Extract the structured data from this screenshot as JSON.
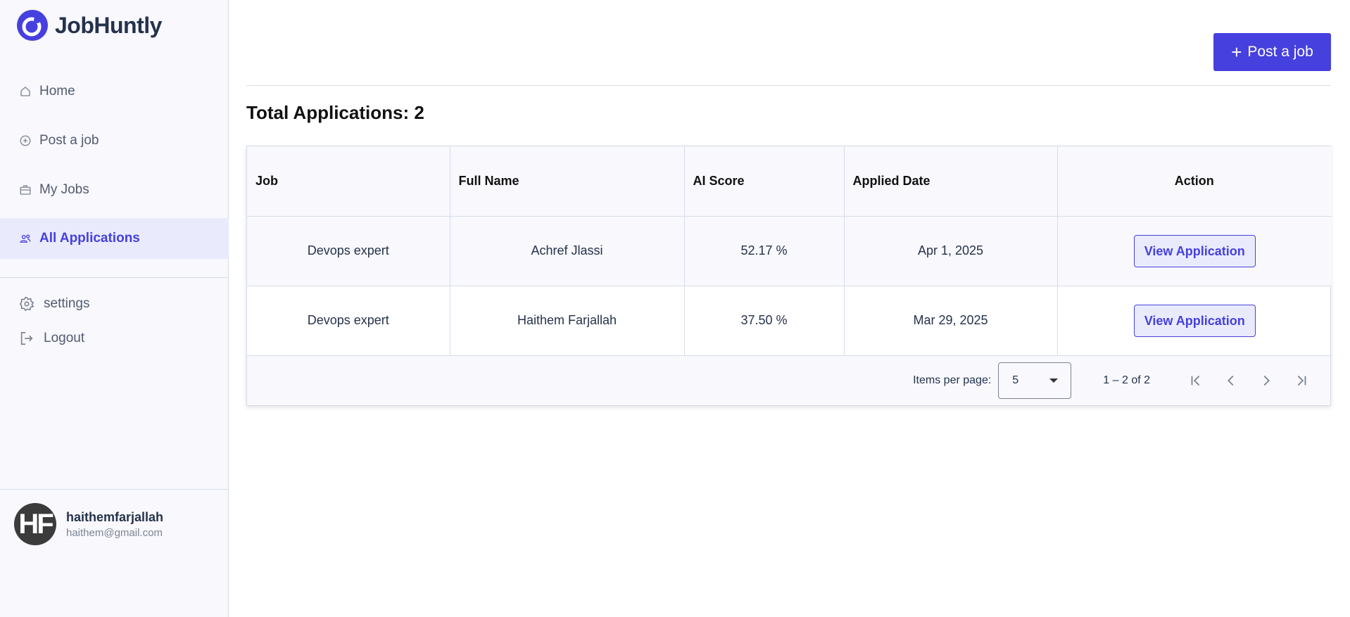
{
  "brand": {
    "name": "JobHuntly"
  },
  "sidebar": {
    "items": [
      {
        "label": "Home",
        "icon": "home-icon"
      },
      {
        "label": "Post a job",
        "icon": "plus-circle-icon"
      },
      {
        "label": "My Jobs",
        "icon": "briefcase-icon"
      },
      {
        "label": "All Applications",
        "icon": "users-icon",
        "active": true
      }
    ],
    "settings_label": "settings",
    "logout_label": "Logout"
  },
  "user": {
    "initials": "HF",
    "name": "haithemfarjallah",
    "email": "haithem@gmail.com"
  },
  "header": {
    "post_button_label": "Post a job"
  },
  "main": {
    "total_label": "Total Applications: 2",
    "table": {
      "headers": [
        "Job",
        "Full Name",
        "AI Score",
        "Applied Date",
        "Action"
      ],
      "rows": [
        {
          "job": "Devops expert",
          "full_name": "Achref Jlassi",
          "ai_score": "52.17 %",
          "applied_date": "Apr 1, 2025",
          "action": "View Application"
        },
        {
          "job": "Devops expert",
          "full_name": "Haithem Farjallah",
          "ai_score": "37.50 %",
          "applied_date": "Mar 29, 2025",
          "action": "View Application"
        }
      ]
    },
    "paginator": {
      "items_per_page_label": "Items per page:",
      "items_per_page_value": "5",
      "range_label": "1 – 2 of 2"
    }
  },
  "colors": {
    "accent": "#4640DE",
    "accent_light": "#E9EBFD",
    "sidebar_bg": "#F8F8FD",
    "border": "#D6DDEB"
  }
}
